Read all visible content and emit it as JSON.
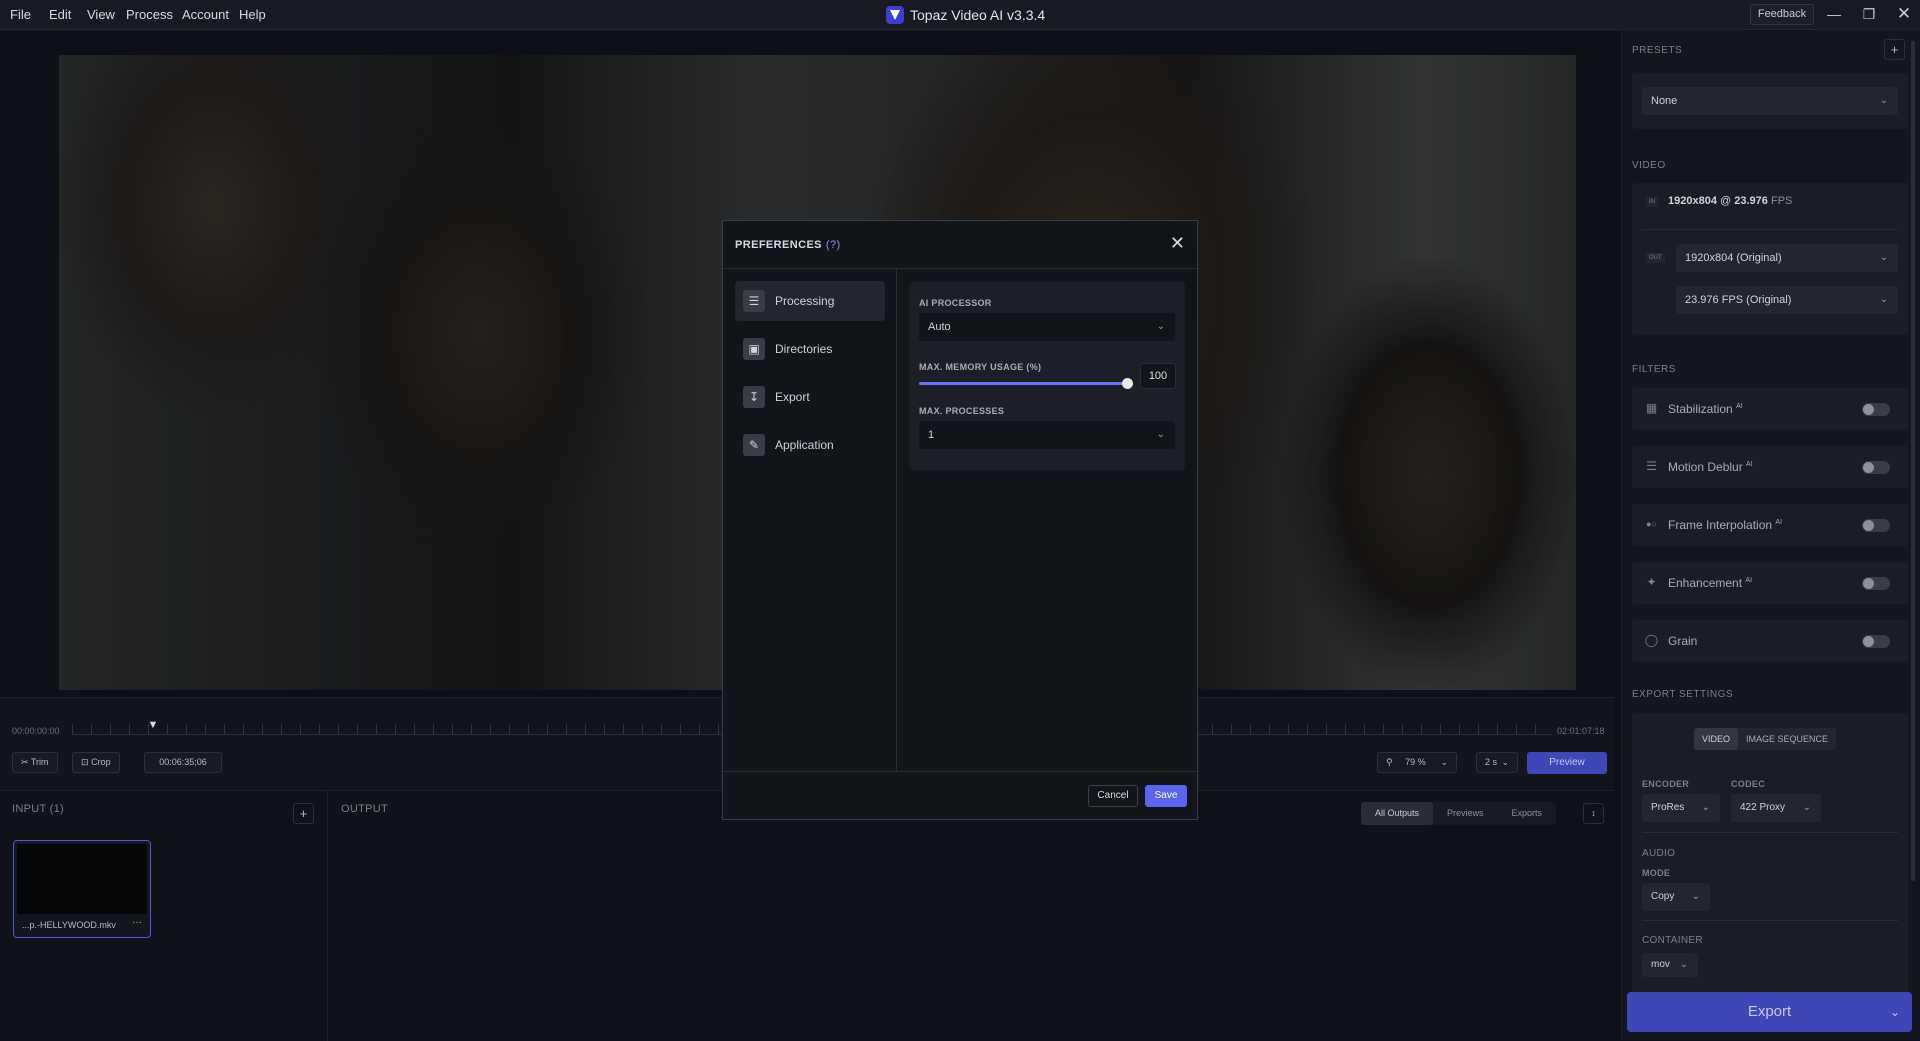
{
  "menu": [
    "File",
    "Edit",
    "View",
    "Process",
    "Account",
    "Help"
  ],
  "app": {
    "title": "Topaz Video AI  v3.3.4",
    "feedback_label": "Feedback"
  },
  "timeline": {
    "start_time": "00:00:00:00",
    "end_time": "02:01:07:18",
    "trim_label": "Trim",
    "crop_label": "Crop",
    "current_time": "00:06:35;06",
    "zoom_value": "79 %",
    "step_value": "2 s",
    "preview_label": "Preview"
  },
  "input": {
    "title": "INPUT (1)",
    "file_name": "...p.-HELLYWOOD.mkv",
    "more": "···"
  },
  "output": {
    "title": "OUTPUT",
    "tabs": [
      "All Outputs",
      "Previews",
      "Exports"
    ],
    "active_tab": "All Outputs"
  },
  "presets": {
    "title": "PRESETS",
    "value": "None"
  },
  "video": {
    "title": "VIDEO",
    "in_badge": "IN",
    "out_badge": "OUT",
    "in_res": "1920x804",
    "in_at": "@",
    "in_fps": "23.976",
    "in_fps_unit": "FPS",
    "out_resolution": "1920x804 (Original)",
    "out_fps": "23.976 FPS (Original)"
  },
  "filters": {
    "title": "FILTERS",
    "items": [
      {
        "label": "Stabilization",
        "ai": "AI",
        "icon": "stabilization-icon",
        "enabled": false
      },
      {
        "label": "Motion Deblur",
        "ai": "AI",
        "icon": "motion-deblur-icon",
        "enabled": false
      },
      {
        "label": "Frame Interpolation",
        "ai": "AI",
        "icon": "frame-interpolation-icon",
        "enabled": false
      },
      {
        "label": "Enhancement",
        "ai": "AI",
        "icon": "enhancement-icon",
        "enabled": false
      },
      {
        "label": "Grain",
        "ai": "",
        "icon": "grain-icon",
        "enabled": false
      }
    ]
  },
  "export_settings": {
    "title": "EXPORT SETTINGS",
    "tabs": [
      "VIDEO",
      "IMAGE SEQUENCE"
    ],
    "active_tab": "VIDEO",
    "encoder_label": "ENCODER",
    "encoder": "ProRes",
    "codec_label": "CODEC",
    "codec": "422 Proxy",
    "audio_label": "AUDIO",
    "mode_label": "MODE",
    "mode": "Copy",
    "container_label": "CONTAINER",
    "container": "mov",
    "export_label": "Export"
  },
  "dialog": {
    "title": "PREFERENCES",
    "help": "(?)",
    "nav": [
      {
        "label": "Processing",
        "icon": "sliders-icon"
      },
      {
        "label": "Directories",
        "icon": "folder-icon"
      },
      {
        "label": "Export",
        "icon": "download-icon"
      },
      {
        "label": "Application",
        "icon": "app-settings-icon"
      }
    ],
    "active_nav": "Processing",
    "ai_processor_label": "AI PROCESSOR",
    "ai_processor": "Auto",
    "memory_label": "MAX. MEMORY USAGE (%)",
    "memory_value": "100",
    "memory_percent": 100,
    "processes_label": "MAX. PROCESSES",
    "processes": "1",
    "cancel_label": "Cancel",
    "save_label": "Save"
  },
  "colors": {
    "accent": "#5b64f0",
    "export_button": "#3f46b8",
    "panel": "#13161c"
  }
}
